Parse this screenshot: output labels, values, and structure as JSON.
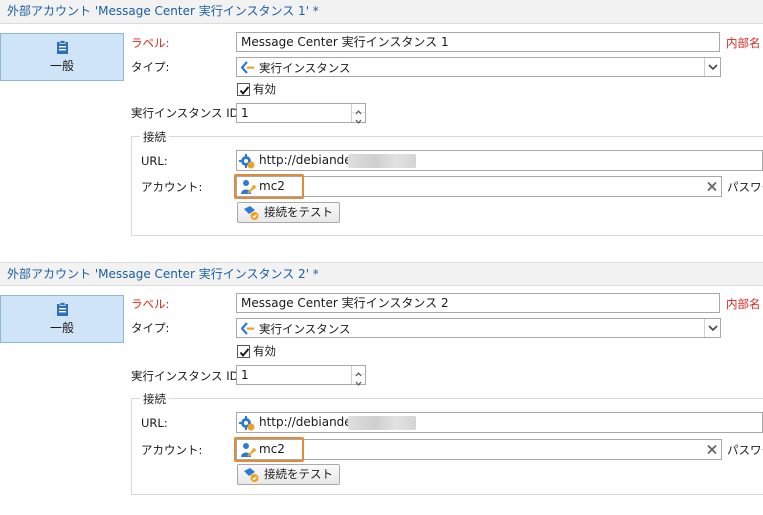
{
  "panels": [
    {
      "title": "外部アカウント 'Message Center 実行インスタンス 1' *",
      "nav_label": "一般",
      "label_caption": "ラベル:",
      "label_value": "Message Center 実行インスタンス 1",
      "internal_name_caption": "内部名",
      "type_caption": "タイプ:",
      "type_value": "実行インスタンス",
      "enabled_label": "有効",
      "enabled_checked": true,
      "instance_id_caption": "実行インスタンス ID:",
      "instance_id_value": "1",
      "connection_legend": "接続",
      "url_caption": "URL:",
      "url_value": "http://debiande",
      "account_caption": "アカウント:",
      "account_value": "mc2",
      "password_caption": "パスワー",
      "test_button": "接続をテスト"
    },
    {
      "title": "外部アカウント 'Message Center 実行インスタンス 2' *",
      "nav_label": "一般",
      "label_caption": "ラベル:",
      "label_value": "Message Center 実行インスタンス 2",
      "internal_name_caption": "内部名",
      "type_caption": "タイプ:",
      "type_value": "実行インスタンス",
      "enabled_label": "有効",
      "enabled_checked": true,
      "instance_id_caption": "実行インスタンス ID:",
      "instance_id_value": "1",
      "connection_legend": "接続",
      "url_caption": "URL:",
      "url_value": "http://debiande",
      "account_caption": "アカウント:",
      "account_value": "mc2",
      "password_caption": "パスワー",
      "test_button": "接続をテスト"
    }
  ],
  "colors": {
    "title_text": "#1a5fa5",
    "required_label": "#d9261c",
    "highlight": "#e38a3a",
    "nav_tile": "#cfe4f7"
  },
  "icons": {
    "nav": "clipboard-icon",
    "type": "execution-instance-icon",
    "url": "gear-globe-icon",
    "account": "user-key-icon",
    "clear": "close-icon",
    "test": "connection-test-icon"
  }
}
